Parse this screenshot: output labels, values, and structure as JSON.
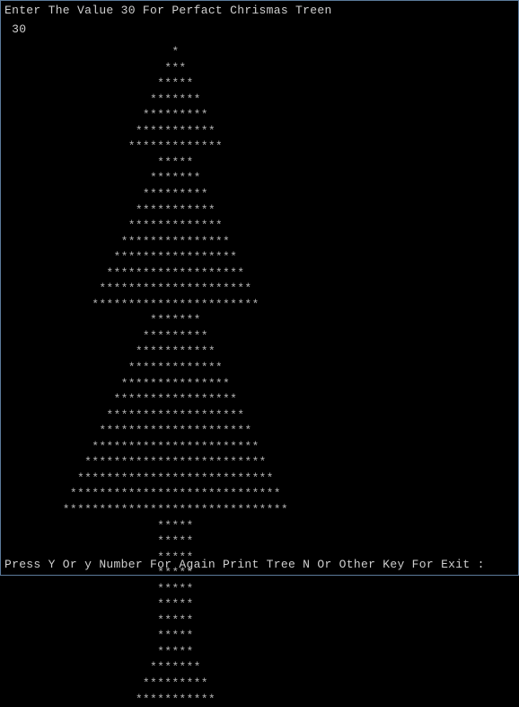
{
  "prompt": "Enter The Value 30 For Perfact Chrismas Treen",
  "input_value": " 30",
  "continue_prompt": "Press Y Or y Number For Again Print Tree N Or Other Key For Exit :",
  "tree_lines": [
    "                       *",
    "                      ***",
    "                     *****",
    "                    *******",
    "                   *********",
    "                  ***********",
    "                 *************",
    "                     *****",
    "                    *******",
    "                   *********",
    "                  ***********",
    "                 *************",
    "                ***************",
    "               *****************",
    "              *******************",
    "             *********************",
    "            ***********************",
    "                    *******",
    "                   *********",
    "                  ***********",
    "                 *************",
    "                ***************",
    "               *****************",
    "              *******************",
    "             *********************",
    "            ***********************",
    "           *************************",
    "          ***************************",
    "         *****************************",
    "        *******************************",
    "                     *****",
    "                     *****",
    "                     *****",
    "                     *****",
    "                     *****",
    "                     *****",
    "                     *****",
    "                     *****",
    "                     *****",
    "                    *******",
    "                   *********",
    "                  ***********"
  ]
}
